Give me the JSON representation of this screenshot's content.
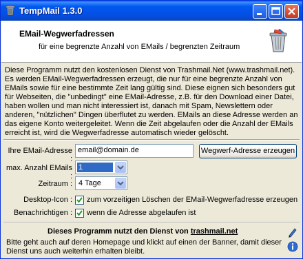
{
  "window": {
    "title": "TempMail 1.3.0"
  },
  "header": {
    "title": "EMail-Wegwerfadressen",
    "subtitle": "für eine begrenzte Anzahl von EMails / begrenzten Zeitraum"
  },
  "description": "Diese Programm nutzt den kostenlosen Dienst von Trashmail.Net (www.trashmail.net). Es werden EMail-Wegwerfadressen erzeugt, die nur für eine begrenzte Anzahl von EMails sowie für eine bestimmte Zeit lang gültig sind. Diese eignen sich besonders gut für Webseiten, die \"unbedingt\" eine EMail-Adresse, z.B. für den Download einer Datei, haben wollen und man nicht interessiert ist, danach mit Spam, Newslettern oder anderen, \"nützlichen\" Dingen überflutet zu werden. EMails an diese Adresse werden an das eigene Konto weitergeleitet. Wenn die Zeit abgelaufen oder die Anzahl der EMails erreicht ist, wird die Wegwerfadresse automatisch wieder gelöscht.",
  "form": {
    "email_label": "Ihre EMail-Adresse :",
    "email_value": "email@domain.de",
    "generate_button": "Wegwerf-Adresse erzeugen",
    "max_label": "max. Anzahl EMails :",
    "max_value": "1",
    "time_label": "Zeitraum :",
    "time_value": "4 Tage",
    "desktop_label": "Desktop-Icon :",
    "desktop_text": "zum vorzeitigen Löschen der EMail-Wegwerfadresse erzeugen",
    "desktop_checked": true,
    "notify_label": "Benachrichtigen :",
    "notify_text": "wenn die Adresse abgelaufen ist",
    "notify_checked": true
  },
  "footer": {
    "title_prefix": "Dieses Programm nutzt den Dienst von ",
    "title_link": "trashmail.net",
    "text": "Bitte geht auch auf deren Homepage und klickt auf einen der Banner, damit dieser Dienst uns auch weiterhin erhalten bleibt."
  },
  "colors": {
    "titlebar": "#0058EE",
    "selection": "#316AC5",
    "dialog_bg": "#ECE9D8"
  },
  "icons": {
    "app": "trash-bin-icon",
    "header": "trash-bin-icon",
    "link": "pen-icon",
    "info": "info-icon"
  }
}
